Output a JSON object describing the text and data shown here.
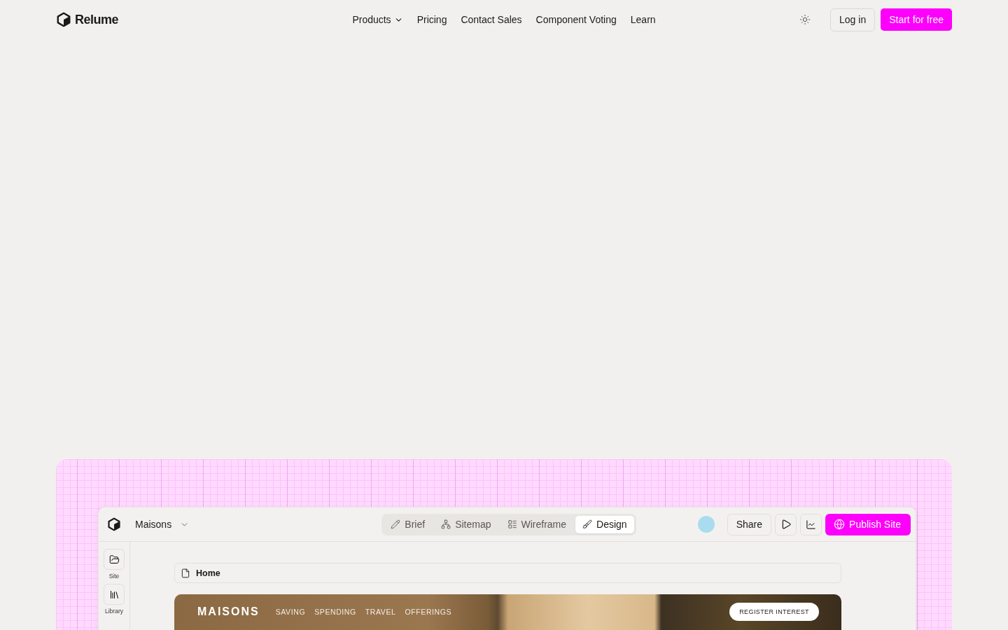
{
  "header": {
    "brand": "Relume",
    "nav": [
      {
        "label": "Products",
        "dropdown": true
      },
      {
        "label": "Pricing",
        "dropdown": false
      },
      {
        "label": "Contact Sales",
        "dropdown": false
      },
      {
        "label": "Component Voting",
        "dropdown": false
      },
      {
        "label": "Learn",
        "dropdown": false
      }
    ],
    "login": "Log in",
    "cta": "Start for free"
  },
  "app": {
    "project": "Maisons",
    "tabs": [
      {
        "label": "Brief",
        "selected": false
      },
      {
        "label": "Sitemap",
        "selected": false
      },
      {
        "label": "Wireframe",
        "selected": false
      },
      {
        "label": "Design",
        "selected": true
      }
    ],
    "share": "Share",
    "publish": "Publish Site",
    "sidebar": [
      {
        "label": "Site"
      },
      {
        "label": "Library"
      }
    ],
    "page": "Home",
    "preview": {
      "brand": "MAISONS",
      "nav": [
        "SAVING",
        "SPENDING",
        "TRAVEL",
        "OFFERINGS"
      ],
      "cta": "REGISTER INTEREST"
    }
  }
}
